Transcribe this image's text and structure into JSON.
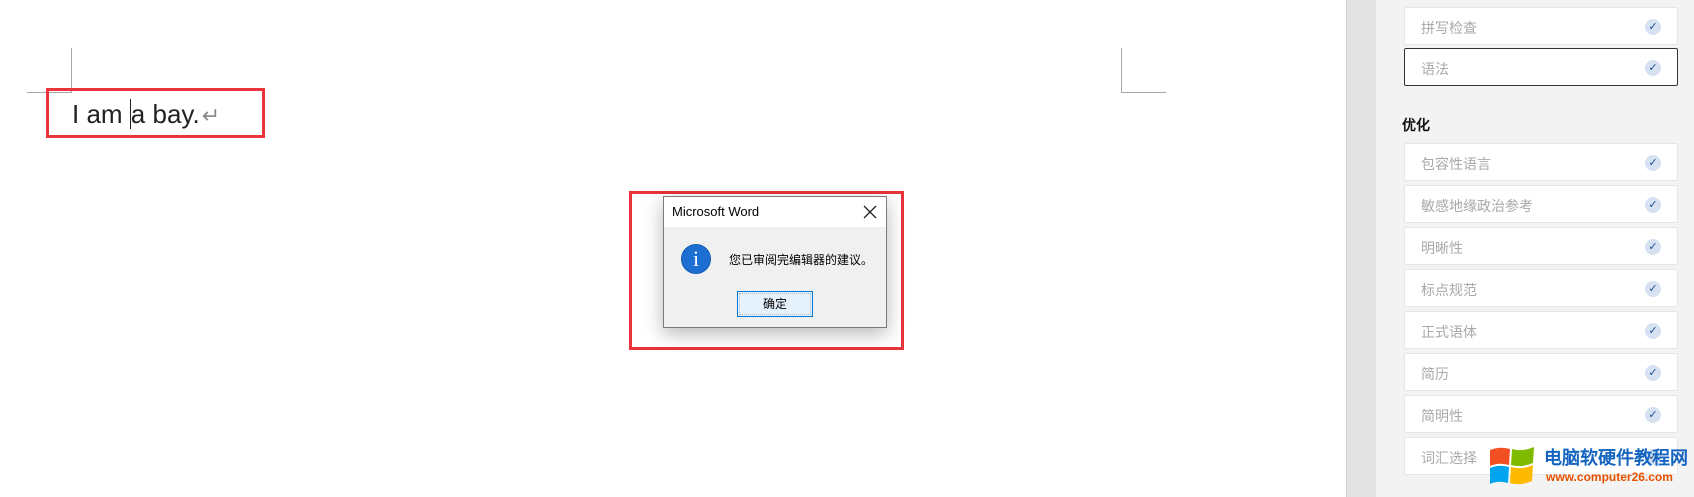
{
  "document": {
    "text_before_cursor": "I am ",
    "text_after_cursor": "a bay.",
    "paragraph_mark": "↵"
  },
  "dialog": {
    "title": "Microsoft Word",
    "message": "您已审阅完编辑器的建议。",
    "ok_label": "确定",
    "icon": "info-icon",
    "close_icon": "close-icon"
  },
  "panel": {
    "items_top": [
      {
        "label": "拼写检查",
        "checked": true
      },
      {
        "label": "语法",
        "checked": true,
        "selected": true
      }
    ],
    "section_title": "优化",
    "items": [
      {
        "label": "包容性语言",
        "checked": true
      },
      {
        "label": "敏感地缘政治参考",
        "checked": true
      },
      {
        "label": "明晰性",
        "checked": true
      },
      {
        "label": "标点规范",
        "checked": true
      },
      {
        "label": "正式语体",
        "checked": true
      },
      {
        "label": "简历",
        "checked": true
      },
      {
        "label": "简明性",
        "checked": true
      },
      {
        "label": "词汇选择",
        "checked": true
      }
    ],
    "check_glyph": "✓"
  },
  "watermark": {
    "title": "电脑软硬件教程网",
    "url": "www.computer26.com"
  },
  "colors": {
    "highlight_box": "#e8343a",
    "accent": "#0078d7",
    "info_blue": "#1c6fd1"
  }
}
